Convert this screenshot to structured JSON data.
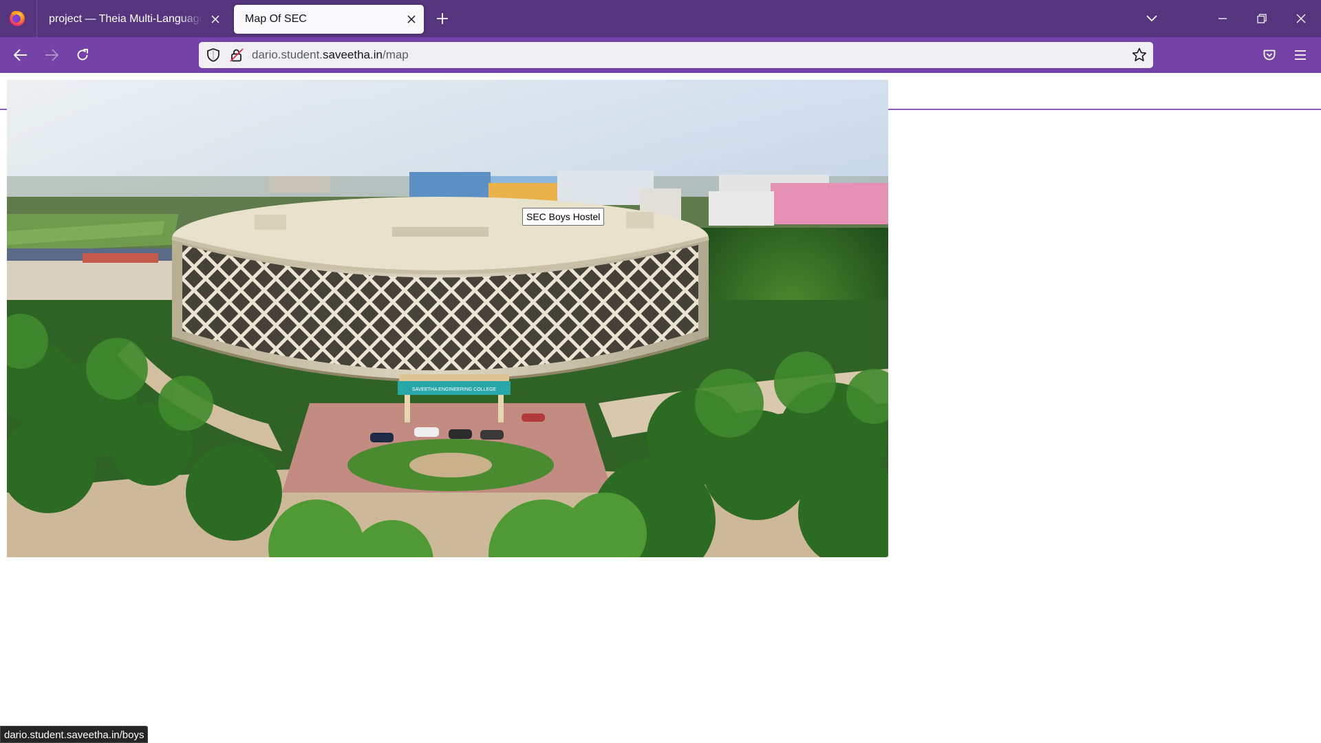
{
  "browser": {
    "tabs": [
      {
        "title": "project — Theia Multi-Language Example",
        "active": false
      },
      {
        "title": "Map Of SEC",
        "active": true
      }
    ],
    "url": {
      "prefix": "dario.student.",
      "domain": "saveetha.in",
      "path": "/map"
    },
    "status_url": "dario.student.saveetha.in/boys"
  },
  "page": {
    "image_alt": "Aerial view of Saveetha Engineering College campus",
    "building_sign": "SAVEETHA ENGINEERING COLLEGE",
    "tooltip": "SEC Boys Hostel"
  },
  "colors": {
    "tabstrip": "#56357f",
    "navbar": "#7543a8",
    "urlbar": "#f0f0f4",
    "active_tab": "#f9f9fb"
  },
  "icons": {
    "app": "firefox-logo-icon",
    "tab_close": "close-icon",
    "new_tab": "plus-icon",
    "list_tabs": "chevron-down-icon",
    "minimize": "minimize-icon",
    "restore": "restore-icon",
    "close_window": "close-icon",
    "back": "arrow-left-icon",
    "forward": "arrow-right-icon",
    "reload": "reload-icon",
    "tracking": "shield-icon",
    "permissions": "lock-icon",
    "bookmark": "star-icon",
    "pocket": "pocket-icon",
    "menu": "hamburger-icon"
  }
}
